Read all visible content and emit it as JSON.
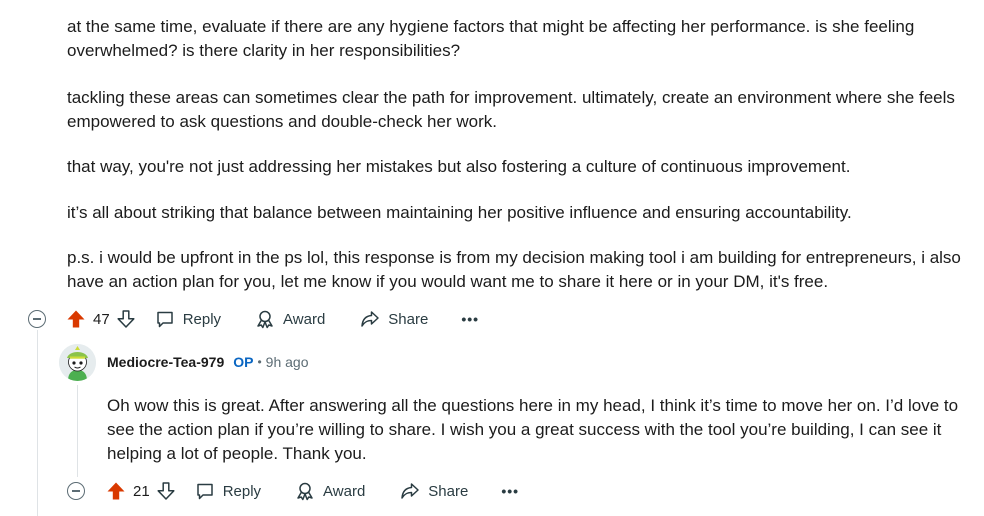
{
  "parent_comment": {
    "paragraphs": [
      "at the same time, evaluate if there are any hygiene factors that might be affecting her performance. is she feeling overwhelmed? is there clarity in her responsibilities?",
      "tackling these areas can sometimes clear the path for improvement. ultimately, create an environment where she feels empowered to ask questions and double-check her work.",
      "that way, you're not just addressing her mistakes but also fostering a culture of continuous improvement.",
      "it’s all about striking that balance between maintaining her positive influence and ensuring accountability.",
      "p.s. i would be upfront in the ps lol, this response is from my decision making tool i am building for entrepreneurs, i also have an action plan for you, let me know if you would want me to share it here or in your DM, it's free."
    ],
    "actions": {
      "vote_count": "47",
      "reply_label": "Reply",
      "award_label": "Award",
      "share_label": "Share",
      "more_label": "•••"
    }
  },
  "reply_comment": {
    "username": "Mediocre-Tea-979",
    "badge": "OP",
    "separator": "•",
    "timestamp": "9h ago",
    "body": "Oh wow this is great. After answering all the questions here in my head, I think it’s time to move her on. I’d love to see the action plan if you’re willing to share. I wish you a great success with the tool you’re building, I can see it helping a lot of people. Thank you.",
    "actions": {
      "vote_count": "21",
      "reply_label": "Reply",
      "award_label": "Award",
      "share_label": "Share",
      "more_label": "•••"
    }
  },
  "colors": {
    "upvote_active": "#d93900",
    "op_badge": "#0a66c2",
    "thread_line": "#dfe3e6",
    "muted_text": "#5c6c74"
  },
  "icons": [
    "collapse-icon",
    "upvote-icon",
    "downvote-icon",
    "reply-icon",
    "award-icon",
    "share-icon",
    "more-icon"
  ]
}
